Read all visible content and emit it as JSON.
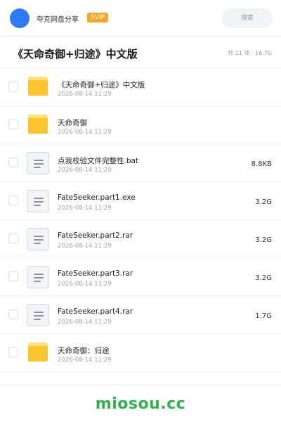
{
  "header": {
    "app_name": "夸克网盘分享",
    "vip_badge": "SVIP",
    "search_placeholder": "搜索"
  },
  "title_bar": {
    "title": "《天命奇御+归途》中文版",
    "summary": "共 11 项 · 16.7G"
  },
  "files": [
    {
      "type": "folder",
      "name": "《天命奇御+归途》中文版",
      "date": "2026-08-14 11:29",
      "size": ""
    },
    {
      "type": "folder",
      "name": "天命奇御",
      "date": "2026-08-14 11:29",
      "size": ""
    },
    {
      "type": "file",
      "name": "点我校验文件完整性.bat",
      "date": "2026-08-14 11:29",
      "size": "8.8KB"
    },
    {
      "type": "file",
      "name": "FateSeeker.part1.exe",
      "date": "2026-08-14 11:29",
      "size": "3.2G"
    },
    {
      "type": "file",
      "name": "FateSeeker.part2.rar",
      "date": "2026-08-14 11:29",
      "size": "3.2G"
    },
    {
      "type": "file",
      "name": "FateSeeker.part3.rar",
      "date": "2026-08-14 11:29",
      "size": "3.2G"
    },
    {
      "type": "file",
      "name": "FateSeeker.part4.rar",
      "date": "2026-08-14 11:29",
      "size": "1.7G"
    },
    {
      "type": "folder",
      "name": "天命奇御：归途",
      "date": "2026-08-14 11:29",
      "size": ""
    }
  ],
  "watermark": "miosou.cc",
  "colors": {
    "avatar": "#2f7bf5",
    "vip_badge": "#f6a524",
    "folder": "#fcc42d",
    "watermark": "#2fb24c"
  }
}
